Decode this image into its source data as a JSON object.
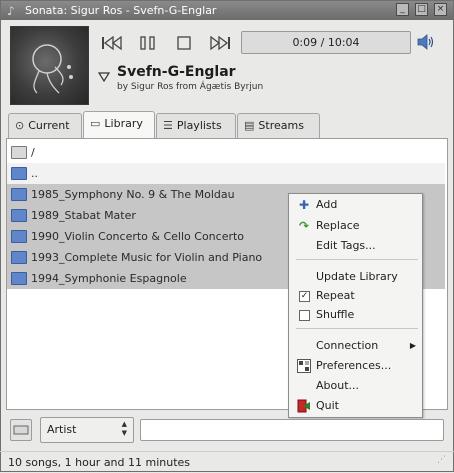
{
  "window": {
    "title": "Sonata: Sigur Ros - Svefn-G-Englar",
    "buttons": {
      "minimize": "_",
      "maximize": "□",
      "close": "×"
    }
  },
  "player": {
    "time": "0:09 / 10:04",
    "song_title": "Svefn-G-Englar",
    "song_subtitle": "by Sigur Ros from Ágætis Byrjun",
    "controls": {
      "prev": "⏮",
      "pause": "⏸",
      "stop": "⏹",
      "next": "⏭"
    }
  },
  "tabs": [
    {
      "label": "Current",
      "icon": "current-icon"
    },
    {
      "label": "Library",
      "icon": "library-icon"
    },
    {
      "label": "Playlists",
      "icon": "playlists-icon"
    },
    {
      "label": "Streams",
      "icon": "streams-icon"
    }
  ],
  "library": {
    "path": "/",
    "up": "..",
    "items": [
      "1985_Symphony No. 9 & The Moldau",
      "1989_Stabat Mater",
      "1990_Violin Concerto & Cello Concerto",
      "1993_Complete Music for Violin and Piano",
      "1994_Symphonie Espagnole"
    ]
  },
  "menu": {
    "add": "Add",
    "replace": "Replace",
    "edit_tags": "Edit Tags...",
    "update_library": "Update Library",
    "repeat": "Repeat",
    "shuffle": "Shuffle",
    "connection": "Connection",
    "preferences": "Preferences...",
    "about": "About...",
    "quit": "Quit"
  },
  "filter": {
    "combo_value": "Artist",
    "text": ""
  },
  "status": "10 songs, 1 hour and 11 minutes"
}
